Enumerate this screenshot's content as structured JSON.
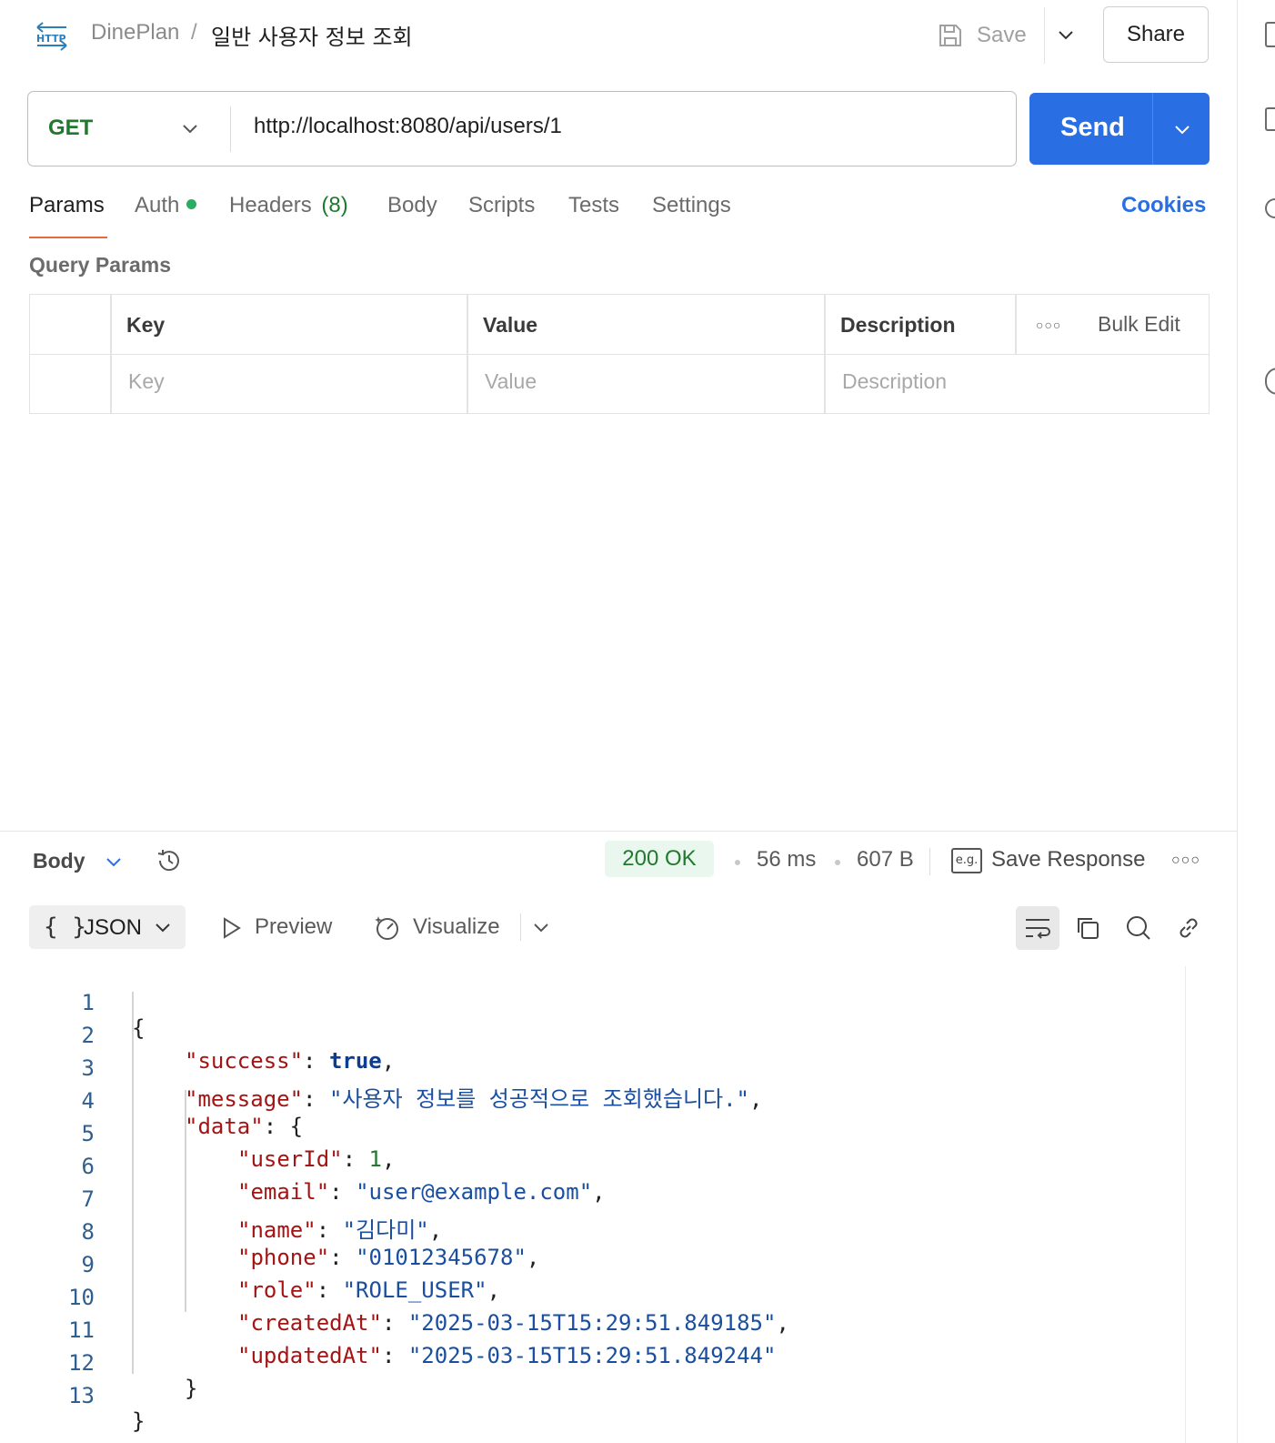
{
  "header": {
    "breadcrumb_workspace": "DinePlan",
    "breadcrumb_separator": "/",
    "request_name": "일반 사용자 정보 조회",
    "save_label": "Save",
    "share_label": "Share",
    "http_badge": "HTTP"
  },
  "request": {
    "method": "GET",
    "url": "http://localhost:8080/api/users/1",
    "send_label": "Send"
  },
  "tabs": [
    {
      "label": "Params",
      "active": true
    },
    {
      "label": "Auth"
    },
    {
      "label": "Headers",
      "count": "(8)"
    },
    {
      "label": "Body"
    },
    {
      "label": "Scripts"
    },
    {
      "label": "Tests"
    },
    {
      "label": "Settings"
    }
  ],
  "cookies_label": "Cookies",
  "query_params": {
    "title": "Query Params",
    "columns": [
      "Key",
      "Value",
      "Description"
    ],
    "bulk_edit_label": "Bulk Edit",
    "placeholders": [
      "Key",
      "Value",
      "Description"
    ]
  },
  "response": {
    "body_label": "Body",
    "status": "200 OK",
    "time": "56 ms",
    "size": "607 B",
    "save_response_label": "Save Response",
    "eg_badge": "e.g.",
    "format_label": "JSON",
    "format_braces": "{ }",
    "preview_label": "Preview",
    "visualize_label": "Visualize",
    "line_numbers": [
      "1",
      "2",
      "3",
      "4",
      "5",
      "6",
      "7",
      "8",
      "9",
      "10",
      "11",
      "12",
      "13"
    ],
    "json_lines": [
      "{",
      "\"success\": true,",
      "\"message\": \"사용자 정보를 성공적으로 조회했습니다.\",",
      "\"data\": {",
      "\"userId\": 1,",
      "\"email\": \"user@example.com\",",
      "\"name\": \"김다미\",",
      "\"phone\": \"01012345678\",",
      "\"role\": \"ROLE_USER\",",
      "\"createdAt\": \"2025-03-15T15:29:51.849185\",",
      "\"updatedAt\": \"2025-03-15T15:29:51.849244\"",
      "}",
      "}"
    ]
  }
}
